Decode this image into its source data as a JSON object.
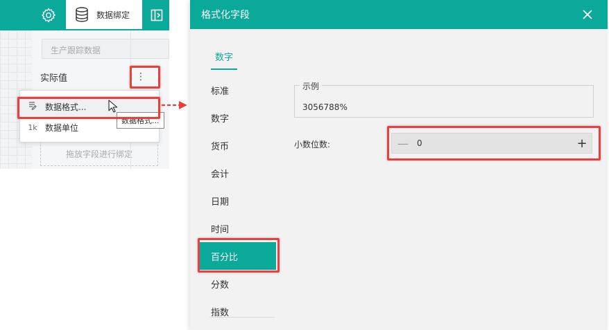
{
  "left_panel": {
    "data_binding_tab": "数据绑定",
    "source_placeholder": "生产跟踪数据",
    "actual_value_label": "实际值",
    "more_icon": "⋮",
    "drop_zone": "拖放字段进行绑定",
    "context_menu": [
      {
        "icon": "format-icon",
        "label": "数据格式..."
      },
      {
        "icon": "1k",
        "label": "数据单位"
      }
    ],
    "tooltip": "数据格式..."
  },
  "dialog": {
    "title": "格式化字段",
    "tab": "数字",
    "categories": [
      "标准",
      "数字",
      "货币",
      "会计",
      "日期",
      "时间",
      "百分比",
      "分数",
      "指数"
    ],
    "selected_category": "百分比",
    "sample_label": "示例",
    "sample_value": "3056788%",
    "decimal_label": "小数位数:",
    "decimal_value": "0",
    "minus": "—",
    "plus": "+"
  },
  "colors": {
    "accent": "#0aa99a",
    "highlight": "#e8403f"
  }
}
